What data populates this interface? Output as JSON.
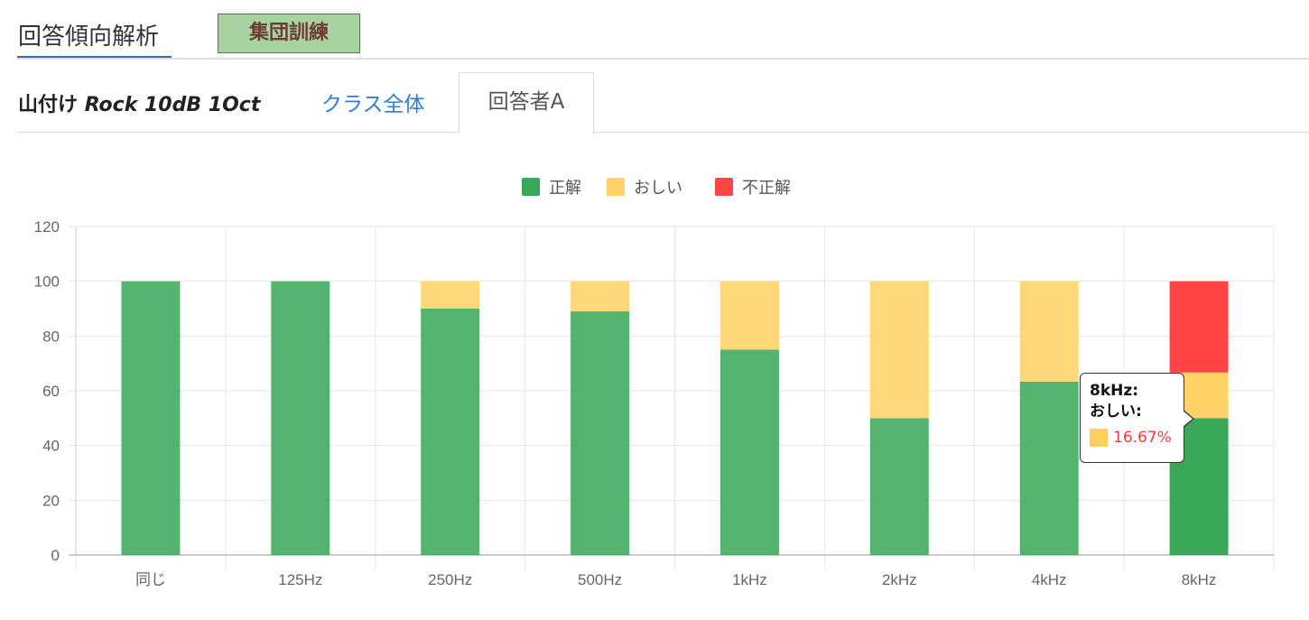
{
  "header": {
    "tab_label": "回答傾向解析",
    "group_button_label": "集団訓練"
  },
  "item": {
    "title_prefix": "山付け",
    "title_italic": "Rock 10dB 1Oct"
  },
  "sub_tabs": [
    {
      "label": "クラス全体",
      "active": false
    },
    {
      "label": "回答者A",
      "active": true
    }
  ],
  "tooltip": {
    "line1": "8kHz:",
    "line2": "おしい:",
    "value": "16.67%"
  },
  "chart_data": {
    "type": "bar",
    "stacked": true,
    "categories": [
      "同じ",
      "125Hz",
      "250Hz",
      "500Hz",
      "1kHz",
      "2kHz",
      "4kHz",
      "8kHz"
    ],
    "series": [
      {
        "name": "正解",
        "color": "#2ea44f",
        "values": [
          100,
          100,
          90,
          89,
          75,
          50,
          63.33,
          50
        ]
      },
      {
        "name": "おしい",
        "color": "#ffcf5e",
        "values": [
          0,
          0,
          10,
          11,
          25,
          50,
          36.67,
          16.67
        ]
      },
      {
        "name": "不正解",
        "color": "#ff3b3b",
        "values": [
          0,
          0,
          0,
          0,
          0,
          0,
          0,
          33.33
        ]
      }
    ],
    "ylim": [
      0,
      120
    ],
    "yticks": [
      0,
      20,
      40,
      60,
      80,
      100,
      120
    ],
    "grid": true,
    "legend_position": "top",
    "xlabel": "",
    "ylabel": "",
    "highlight_index": 7
  }
}
